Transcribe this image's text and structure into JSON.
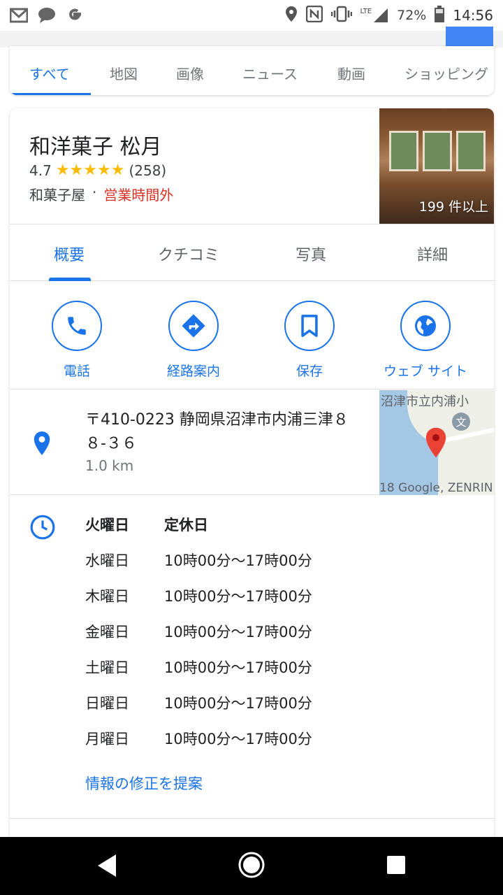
{
  "status_bar": {
    "icons_left": [
      "gmail-icon",
      "messages-icon",
      "google-icon"
    ],
    "icons_right": [
      "location-icon",
      "nfc-icon",
      "vibrate-icon",
      "lte-signal-icon"
    ],
    "lte": "LTE",
    "battery": "72%",
    "time": "14:56"
  },
  "search_tabs": [
    {
      "label": "すべて",
      "active": true
    },
    {
      "label": "地図",
      "active": false
    },
    {
      "label": "画像",
      "active": false
    },
    {
      "label": "ニュース",
      "active": false
    },
    {
      "label": "動画",
      "active": false
    },
    {
      "label": "ショッピング",
      "active": false
    }
  ],
  "place": {
    "name": "和洋菓子 松月",
    "rating": "4.7",
    "stars": "★★★★★",
    "review_count": "(258)",
    "category": "和菓子屋",
    "separator": "·",
    "status": "営業時間外",
    "photo_count": "199 件以上"
  },
  "place_tabs": [
    "概要",
    "クチコミ",
    "写真",
    "詳細"
  ],
  "actions": [
    {
      "label": "電話",
      "icon": "phone-icon"
    },
    {
      "label": "経路案内",
      "icon": "directions-icon"
    },
    {
      "label": "保存",
      "icon": "bookmark-icon"
    },
    {
      "label": "ウェブ サイト",
      "icon": "globe-icon"
    }
  ],
  "address": {
    "text": "〒410-0223 静岡県沼津市内浦三津８８-３６",
    "distance": "1.0 km",
    "map_label": "沼津市立内浦小",
    "map_attribution": "18 Google, ZENRIN",
    "map_poi": "文"
  },
  "hours": [
    {
      "day": "火曜日",
      "time": "定休日",
      "bold": true
    },
    {
      "day": "水曜日",
      "time": "10時00分～17時00分"
    },
    {
      "day": "木曜日",
      "time": "10時00分～17時00分"
    },
    {
      "day": "金曜日",
      "time": "10時00分～17時00分"
    },
    {
      "day": "土曜日",
      "time": "10時00分～17時00分"
    },
    {
      "day": "日曜日",
      "time": "10時00分～17時00分"
    },
    {
      "day": "月曜日",
      "time": "10時00分～17時00分"
    }
  ],
  "suggest_edit": "情報の修正を提案",
  "colors": {
    "accent": "#1a73e8",
    "closed": "#d93025",
    "star": "#fbbc04"
  }
}
